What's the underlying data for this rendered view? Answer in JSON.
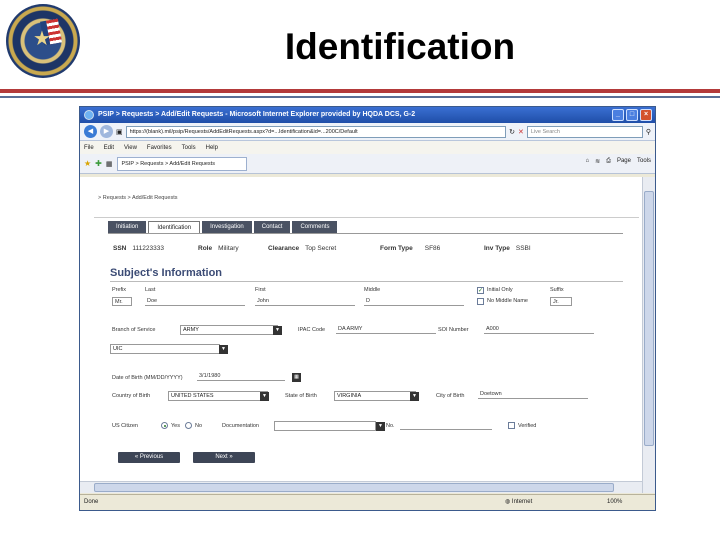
{
  "slide": {
    "title": "Identification"
  },
  "browser": {
    "window_title": "PSIP > Requests > Add/Edit Requests - Microsoft Internet Explorer provided by HQDA DCS, G-2",
    "url": "https://(blank).mil/psip/Requests/AddEditRequests.aspx?d=...Identification&id=...200C/Default",
    "search_placeholder": "Live Search",
    "menu": [
      "File",
      "Edit",
      "View",
      "Favorites",
      "Tools",
      "Help"
    ],
    "tab_title": "PSIP > Requests > Add/Edit Requests",
    "tools": [
      "Page",
      "Tools"
    ],
    "status_left": "Done",
    "status_zone": "Internet",
    "status_zoom": "100%"
  },
  "page": {
    "breadcrumb": "> Requests > Add/Edit Requests",
    "tabs": [
      "Initiation",
      "Identification",
      "Investigation",
      "Contact",
      "Comments"
    ],
    "active_tab": "Identification",
    "summary": {
      "ssn_label": "SSN",
      "ssn_value": "111223333",
      "role_label": "Role",
      "role_value": "Military",
      "clearance_label": "Clearance",
      "clearance_value": "Top Secret",
      "form_type_label": "Form Type",
      "form_type_value": "SF86",
      "inv_type_label": "Inv Type",
      "inv_type_value": "SSBI"
    },
    "section_title": "Subject's Information",
    "name": {
      "prefix_label": "Prefix",
      "prefix_value": "Mr.",
      "last_label": "Last",
      "last_value": "Doe",
      "first_label": "First",
      "first_value": "John",
      "middle_label": "Middle",
      "middle_value": "D",
      "initial_only": "Initial Only",
      "no_middle_name": "No Middle Name",
      "suffix_label": "Suffix",
      "suffix_value": "Jr."
    },
    "branch": {
      "label": "Branch of Service",
      "value": "ARMY",
      "ipac_label": "IPAC Code",
      "ipac_value": "DA ARMY",
      "soi_label": "SOI Number",
      "soi_value": "A000"
    },
    "uic_value": "UIC",
    "dob": {
      "label": "Date of Birth (MM/DD/YYYY)",
      "value": "3/1/1980"
    },
    "birth": {
      "country_label": "Country of Birth",
      "country_value": "UNITED STATES",
      "state_label": "State of Birth",
      "state_value": "VIRGINIA",
      "city_label": "City of Birth",
      "city_value": "Doetown"
    },
    "citizen": {
      "label": "US Citizen",
      "yes": "Yes",
      "no": "No",
      "doc_label": "Documentation",
      "no_label": "No.",
      "verified": "Verified"
    },
    "buttons": {
      "previous": "« Previous",
      "next": "Next »"
    }
  }
}
